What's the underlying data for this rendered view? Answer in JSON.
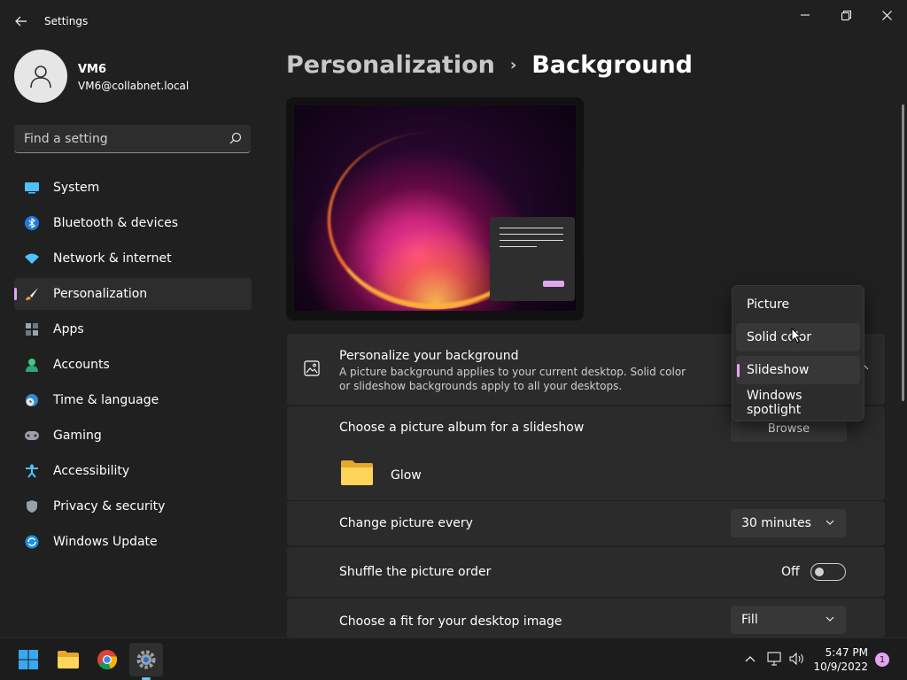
{
  "window": {
    "title": "Settings"
  },
  "colors": {
    "accent": "#e2a4f0",
    "background": "#202020",
    "card": "#2b2b2b"
  },
  "user": {
    "name": "VM6",
    "email": "VM6@collabnet.local"
  },
  "search": {
    "placeholder": "Find a setting"
  },
  "sidebar": {
    "items": [
      {
        "label": "System",
        "icon": "system-icon"
      },
      {
        "label": "Bluetooth & devices",
        "icon": "bluetooth-icon"
      },
      {
        "label": "Network & internet",
        "icon": "wifi-icon"
      },
      {
        "label": "Personalization",
        "icon": "brush-icon",
        "active": true
      },
      {
        "label": "Apps",
        "icon": "apps-icon"
      },
      {
        "label": "Accounts",
        "icon": "person-icon"
      },
      {
        "label": "Time & language",
        "icon": "globe-clock-icon"
      },
      {
        "label": "Gaming",
        "icon": "gamepad-icon"
      },
      {
        "label": "Accessibility",
        "icon": "accessibility-icon"
      },
      {
        "label": "Privacy & security",
        "icon": "shield-icon"
      },
      {
        "label": "Windows Update",
        "icon": "update-icon"
      }
    ]
  },
  "breadcrumb": {
    "parent": "Personalization",
    "separator": "›",
    "current": "Background"
  },
  "background_card": {
    "title": "Personalize your background",
    "description": "A picture background applies to your current desktop. Solid color or slideshow backgrounds apply to all your desktops."
  },
  "album": {
    "title": "Choose a picture album for a slideshow",
    "browse_label": "Browse",
    "folder_name": "Glow"
  },
  "change_picture": {
    "title": "Change picture every",
    "value": "30 minutes"
  },
  "shuffle": {
    "title": "Shuffle the picture order",
    "state_label": "Off"
  },
  "fit": {
    "title": "Choose a fit for your desktop image",
    "value": "Fill"
  },
  "flyout": {
    "options": [
      "Picture",
      "Solid color",
      "Slideshow",
      "Windows spotlight"
    ],
    "selected": "Slideshow",
    "hovered": "Solid color"
  },
  "taskbar": {
    "apps": [
      "windows-start-icon",
      "file-explorer-icon",
      "chrome-icon",
      "settings-icon"
    ],
    "time": "5:47 PM",
    "date": "10/9/2022",
    "notification_count": "1"
  }
}
